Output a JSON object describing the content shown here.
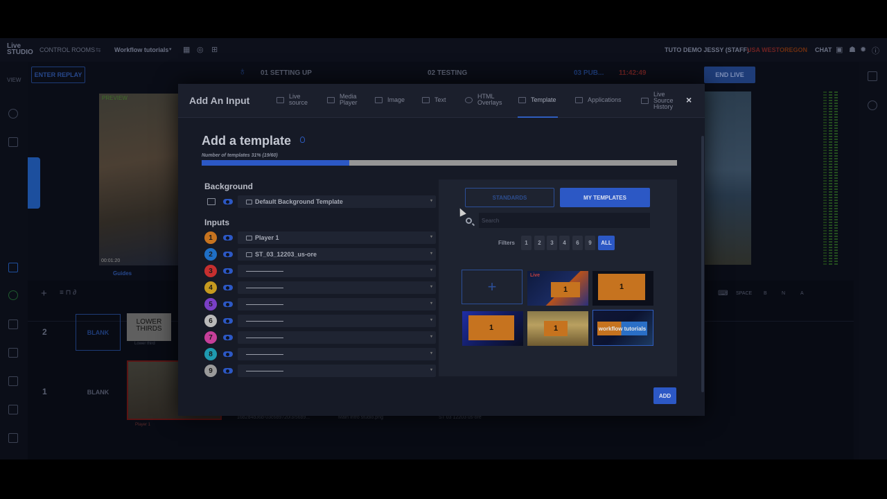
{
  "app": {
    "logo_top": "Live",
    "logo_bottom": "STUDIO",
    "control_rooms": "CONTROL ROOMS",
    "room_name": "Workflow tutorials",
    "user": "TUTO DEMO JESSY (STAFF)",
    "region": "USA WEST",
    "region_sub": "OREGON",
    "chat": "CHAT",
    "view": "VIEW",
    "enter_replay": "ENTER REPLAY",
    "step1": "01 SETTING UP",
    "step2": "02 TESTING",
    "step3": "03 PUB...",
    "timer": "11:42:49",
    "end_live": "END LIVE",
    "preview_label": "PREVIEW",
    "preview_time": "00:01:20",
    "guides": "Guides",
    "row2_num": "2",
    "row1_num": "1",
    "blank": "BLANK",
    "lower_thirds": "LOWER THIRDS",
    "lower_third_caption": "Lower third",
    "player_caption": "Player 1",
    "bottom_file1": "16b2d4d36b-03c6b9720/3/56b9...",
    "bottom_file2": "Main intro studio.png",
    "bottom_file3": "ST 03 12203 us-ore",
    "space": "SPACE",
    "key_b": "B",
    "key_n": "N",
    "key_a": "A"
  },
  "modal": {
    "title": "Add An Input",
    "tabs": [
      {
        "label": "Live source"
      },
      {
        "label": "Media Player"
      },
      {
        "label": "Image"
      },
      {
        "label": "Text"
      },
      {
        "label": "HTML Overlays"
      },
      {
        "label": "Template"
      },
      {
        "label": "Applications"
      },
      {
        "label": "Live Source History"
      }
    ],
    "active_tab": "Template",
    "section_title": "Add a template",
    "template_count": "Number of templates 31% (19/60)",
    "progress_percent": 31,
    "background_label": "Background",
    "background_value": "Default Background Template",
    "inputs_label": "Inputs",
    "inputs": [
      {
        "num": "1",
        "color": "#c6731f",
        "value": "Player 1"
      },
      {
        "num": "2",
        "color": "#1f6fc6",
        "value": "ST_03_12203_us-ore"
      },
      {
        "num": "3",
        "color": "#c62f2f",
        "value": "——————"
      },
      {
        "num": "4",
        "color": "#c69a1f",
        "value": "——————"
      },
      {
        "num": "5",
        "color": "#7a3fc6",
        "value": "——————"
      },
      {
        "num": "6",
        "color": "#b9b9b9",
        "value": "——————"
      },
      {
        "num": "7",
        "color": "#c63f9a",
        "value": "——————"
      },
      {
        "num": "8",
        "color": "#1f9ab0",
        "value": "——————"
      },
      {
        "num": "9",
        "color": "#9a9a9a",
        "value": "——————"
      }
    ],
    "standards_label": "STANDARDS",
    "my_templates_label": "MY TEMPLATES",
    "search_placeholder": "Search",
    "filters_label": "Filters",
    "filters": [
      "1",
      "2",
      "3",
      "4",
      "6",
      "9",
      "ALL"
    ],
    "add_symbol": "+",
    "template_labels": [
      "1",
      "1",
      "1",
      "1",
      "workflow tutorials"
    ],
    "template_logo": "Live",
    "add_button": "ADD",
    "close_symbol": "×"
  }
}
